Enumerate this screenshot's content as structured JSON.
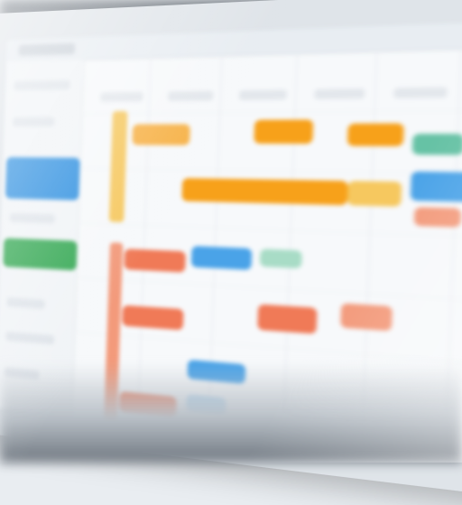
{
  "view": {
    "accent_colors": {
      "orange": "#f7a11a",
      "yellow": "#f6c85f",
      "blue": "#2d8fe0",
      "light_blue": "#4aa3e8",
      "green": "#34a853",
      "salmon": "#f07a57",
      "teal": "#66c2a5",
      "purple": "#9b7fd1"
    },
    "sidebar_items": [
      {
        "kind": "placeholder"
      },
      {
        "kind": "placeholder"
      },
      {
        "kind": "accent-block",
        "color": "blue"
      },
      {
        "kind": "placeholder"
      },
      {
        "kind": "accent-block",
        "color": "green"
      },
      {
        "kind": "placeholder"
      },
      {
        "kind": "placeholder"
      },
      {
        "kind": "placeholder"
      }
    ],
    "tasks": [
      {
        "color": "orange"
      },
      {
        "color": "orange"
      },
      {
        "color": "orange"
      },
      {
        "color": "yellow"
      },
      {
        "color": "orange"
      },
      {
        "color": "orange"
      },
      {
        "color": "teal"
      },
      {
        "color": "light_blue"
      },
      {
        "color": "salmon"
      },
      {
        "color": "light_blue"
      },
      {
        "color": "teal"
      },
      {
        "color": "salmon"
      },
      {
        "color": "salmon"
      },
      {
        "color": "salmon"
      },
      {
        "color": "light_blue"
      },
      {
        "color": "salmon"
      },
      {
        "color": "light_blue"
      },
      {
        "color": "purple"
      },
      {
        "color": "green"
      }
    ]
  }
}
